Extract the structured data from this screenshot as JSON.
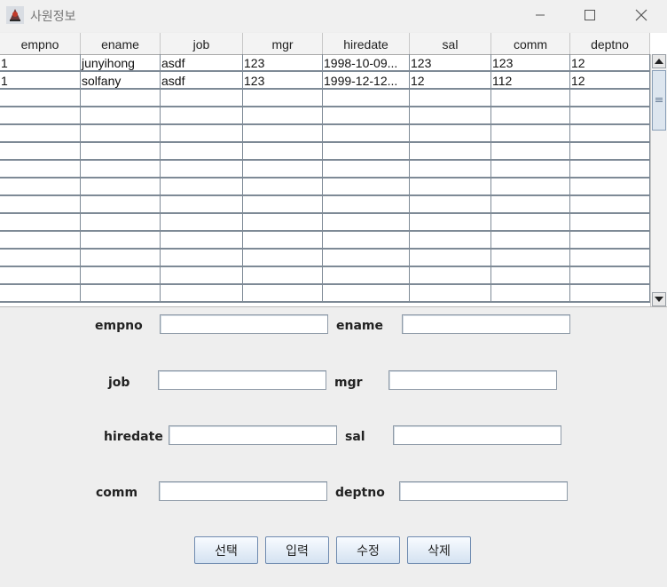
{
  "window": {
    "title": "사원정보"
  },
  "table": {
    "columns": [
      "empno",
      "ename",
      "job",
      "mgr",
      "hiredate",
      "sal",
      "comm",
      "deptno"
    ],
    "rows": [
      [
        "1",
        "junyihong",
        "asdf",
        "123",
        "1998-10-09...",
        "123",
        "123",
        "12"
      ],
      [
        "1",
        "solfany",
        "asdf",
        "123",
        "1999-12-12...",
        "12",
        "112",
        "12"
      ]
    ],
    "empty_row_count": 12
  },
  "form": {
    "empno_label": "empno",
    "ename_label": "ename",
    "job_label": "job",
    "mgr_label": "mgr",
    "hiredate_label": "hiredate",
    "sal_label": "sal",
    "comm_label": "comm",
    "deptno_label": "deptno",
    "empno_value": "",
    "ename_value": "",
    "job_value": "",
    "mgr_value": "",
    "hiredate_value": "",
    "sal_value": "",
    "comm_value": "",
    "deptno_value": ""
  },
  "buttons": {
    "select": "선택",
    "insert": "입력",
    "update": "수정",
    "delete": "삭제"
  },
  "icons": {
    "app": "java-app-icon",
    "minimize": "minimize-icon",
    "maximize": "maximize-icon",
    "close": "close-icon",
    "scroll_up": "arrow-up-icon",
    "scroll_down": "arrow-down-icon"
  },
  "colors": {
    "window_bg": "#eeeeee",
    "grid_line": "#7e8a96",
    "button_border": "#6f8bb0"
  }
}
